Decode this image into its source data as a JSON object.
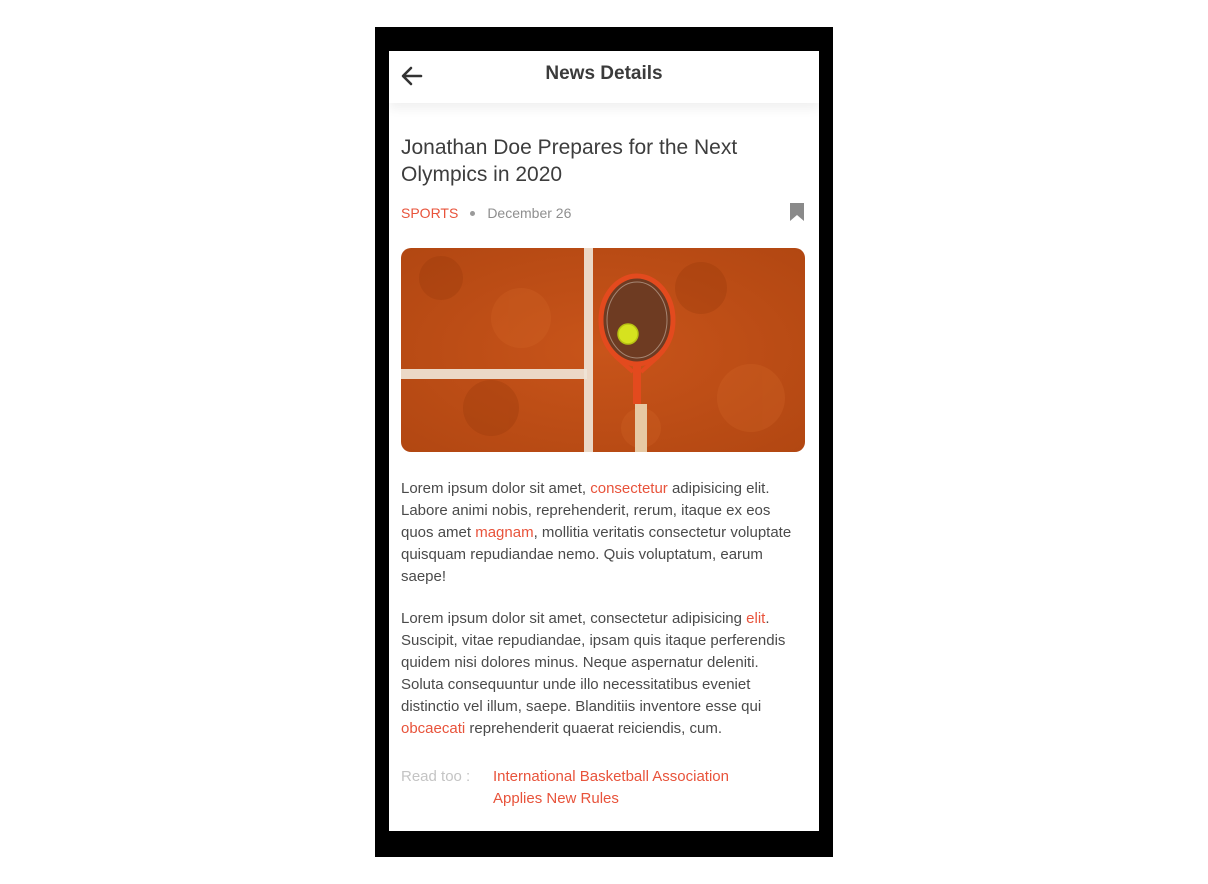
{
  "app_bar": {
    "title": "News Details",
    "back_icon": "arrow-left-icon"
  },
  "article": {
    "headline": "Jonathan Doe Prepares for the Next Olympics in 2020",
    "category": "SPORTS",
    "date": "December 26",
    "bookmark_icon": "bookmark-icon",
    "image_subject": "tennis racket with ball on clay court",
    "paragraph_1": [
      {
        "text": "Lorem ipsum dolor sit amet, ",
        "hl": false
      },
      {
        "text": "consectetur",
        "hl": true
      },
      {
        "text": " adipisicing elit. Labore animi nobis, reprehenderit, rerum, itaque ex eos quos amet ",
        "hl": false
      },
      {
        "text": "magnam",
        "hl": true
      },
      {
        "text": ", mollitia veritatis consectetur voluptate quisquam repudiandae nemo. Quis voluptatum, earum saepe!",
        "hl": false
      }
    ],
    "paragraph_2": [
      {
        "text": "Lorem ipsum dolor sit amet, consectetur adipisicing ",
        "hl": false
      },
      {
        "text": "elit",
        "hl": true
      },
      {
        "text": ". Suscipit, vitae repudiandae, ipsam quis itaque perferendis quidem nisi dolores minus. Neque aspernatur deleniti. Soluta consequuntur unde illo necessitatibus eveniet distinctio vel illum, saepe. Blanditiis inventore esse qui ",
        "hl": false
      },
      {
        "text": "obcaecati",
        "hl": true
      },
      {
        "text": " reprehenderit quaerat reiciendis, cum.",
        "hl": false
      }
    ]
  },
  "read_too": {
    "label": "Read too :",
    "link": "International Basketball Association Applies New Rules"
  },
  "colors": {
    "accent": "#e8533b",
    "frame": "#000000",
    "text": "#4a4a4a",
    "muted": "#8f8f8f"
  }
}
